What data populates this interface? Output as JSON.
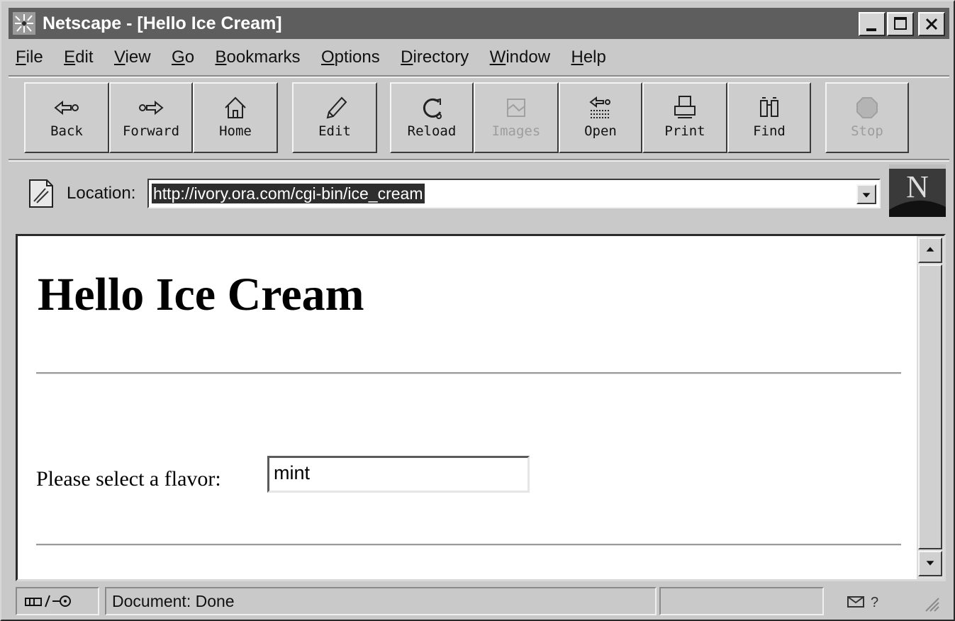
{
  "window": {
    "title": "Netscape - [Hello Ice Cream]"
  },
  "menu": {
    "items": [
      {
        "label": "File",
        "mnemonic": "F",
        "rest": "ile"
      },
      {
        "label": "Edit",
        "mnemonic": "E",
        "rest": "dit"
      },
      {
        "label": "View",
        "mnemonic": "V",
        "rest": "iew"
      },
      {
        "label": "Go",
        "mnemonic": "G",
        "rest": "o"
      },
      {
        "label": "Bookmarks",
        "mnemonic": "B",
        "rest": "ookmarks"
      },
      {
        "label": "Options",
        "mnemonic": "O",
        "rest": "ptions"
      },
      {
        "label": "Directory",
        "mnemonic": "D",
        "rest": "irectory"
      },
      {
        "label": "Window",
        "mnemonic": "W",
        "rest": "indow"
      },
      {
        "label": "Help",
        "mnemonic": "H",
        "rest": "elp"
      }
    ]
  },
  "toolbar": {
    "back": "Back",
    "forward": "Forward",
    "home": "Home",
    "edit": "Edit",
    "reload": "Reload",
    "images": "Images",
    "open": "Open",
    "print": "Print",
    "find": "Find",
    "stop": "Stop"
  },
  "location": {
    "label": "Location:",
    "url": "http://ivory.ora.com/cgi-bin/ice_cream"
  },
  "page": {
    "heading": "Hello Ice Cream",
    "flavor_label": "Please select a flavor:",
    "flavor_value": "mint"
  },
  "status": {
    "text": "Document: Done"
  },
  "icons": {
    "app": "netscape-starfield-icon",
    "minimize": "minimize-icon",
    "maximize": "maximize-icon",
    "close": "close-icon",
    "location": "page-link-icon",
    "logo": "netscape-n-logo",
    "security": "security-key-icon",
    "mail": "mail-icon"
  },
  "colors": {
    "titlebar": "#5e5e5e",
    "chrome": "#c9c9c9",
    "selection": "#2e2e2e"
  }
}
